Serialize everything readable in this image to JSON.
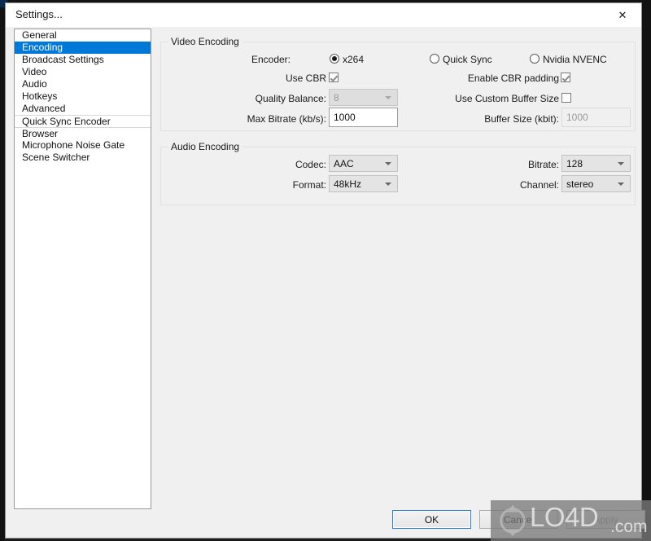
{
  "window": {
    "title": "Settings...",
    "close_icon": "close-icon",
    "close_glyph": "✕"
  },
  "sidebar": {
    "items": [
      {
        "label": "General",
        "selected": false,
        "sep_above": false
      },
      {
        "label": "Encoding",
        "selected": true,
        "sep_above": false
      },
      {
        "label": "Broadcast Settings",
        "selected": false,
        "sep_above": false
      },
      {
        "label": "Video",
        "selected": false,
        "sep_above": false
      },
      {
        "label": "Audio",
        "selected": false,
        "sep_above": false
      },
      {
        "label": "Hotkeys",
        "selected": false,
        "sep_above": false
      },
      {
        "label": "Advanced",
        "selected": false,
        "sep_above": false
      },
      {
        "label": "Quick Sync Encoder",
        "selected": false,
        "sep_above": true
      },
      {
        "label": "Browser",
        "selected": false,
        "sep_above": true
      },
      {
        "label": "Microphone Noise Gate",
        "selected": false,
        "sep_above": false
      },
      {
        "label": "Scene Switcher",
        "selected": false,
        "sep_above": false
      }
    ]
  },
  "video_encoding": {
    "group_label": "Video Encoding",
    "encoder_label": "Encoder:",
    "encoder_options": [
      {
        "label": "x264",
        "selected": true
      },
      {
        "label": "Quick Sync",
        "selected": false
      },
      {
        "label": "Nvidia NVENC",
        "selected": false
      }
    ],
    "use_cbr_label": "Use CBR",
    "use_cbr_checked": true,
    "enable_cbr_padding_label": "Enable CBR padding",
    "enable_cbr_padding_checked": true,
    "quality_balance_label": "Quality Balance:",
    "quality_balance_value": "8",
    "use_custom_buffer_label": "Use Custom Buffer Size",
    "use_custom_buffer_checked": false,
    "max_bitrate_label": "Max Bitrate (kb/s):",
    "max_bitrate_value": "1000",
    "buffer_size_label": "Buffer Size (kbit):",
    "buffer_size_value": "1000"
  },
  "audio_encoding": {
    "group_label": "Audio Encoding",
    "codec_label": "Codec:",
    "codec_value": "AAC",
    "format_label": "Format:",
    "format_value": "48kHz",
    "bitrate_label": "Bitrate:",
    "bitrate_value": "128",
    "channel_label": "Channel:",
    "channel_value": "stereo"
  },
  "buttons": {
    "ok": "OK",
    "cancel": "Cancel",
    "apply": "Apply"
  },
  "watermark": {
    "text": "LO4D",
    "suffix": ".com",
    "logo_icon": "refresh-arrows-icon"
  },
  "colors": {
    "accent": "#0078d7",
    "dialog_bg": "#f0f0f0",
    "list_bg": "#ffffff",
    "titlebar_bg": "#ffffff",
    "focus_border": "#2a7fd4"
  }
}
